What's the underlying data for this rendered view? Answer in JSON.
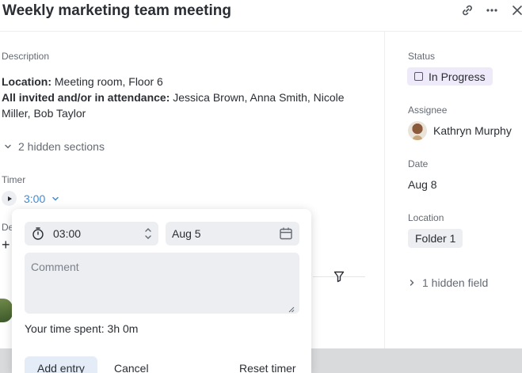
{
  "header": {
    "title": "Weekly marketing team meeting",
    "icons": [
      "link-icon",
      "more-icon",
      "close-icon"
    ]
  },
  "main": {
    "description_label": "Description",
    "location_key": "Location:",
    "location_value": " Meeting room, Floor 6",
    "attendance_key": "All invited and/or in attendance:",
    "attendance_value": " Jessica Brown, Anna Smith, Nicole Miller, Bob Taylor",
    "hidden_sections": "2 hidden sections",
    "timer_label": "Timer",
    "timer_value": "3:00",
    "partial_label": "De",
    "partial_plus": "+"
  },
  "popover": {
    "time_value": "03:00",
    "date_value": "Aug 5",
    "comment_placeholder": "Comment",
    "time_spent": "Your time spent: 3h 0m",
    "add_entry": "Add entry",
    "cancel": "Cancel",
    "reset_timer": "Reset timer"
  },
  "sidebar": {
    "status_label": "Status",
    "status_value": "In Progress",
    "assignee_label": "Assignee",
    "assignee_value": "Kathryn Murphy",
    "date_label": "Date",
    "date_value": "Aug 8",
    "location_label": "Location",
    "location_value": "Folder 1",
    "hidden_field": "1 hidden field"
  },
  "colors": {
    "accent_blue": "#3b8be0",
    "status_purple": "#5b47b8",
    "status_bg": "#eeeaf9",
    "field_bg": "#eceef1"
  }
}
